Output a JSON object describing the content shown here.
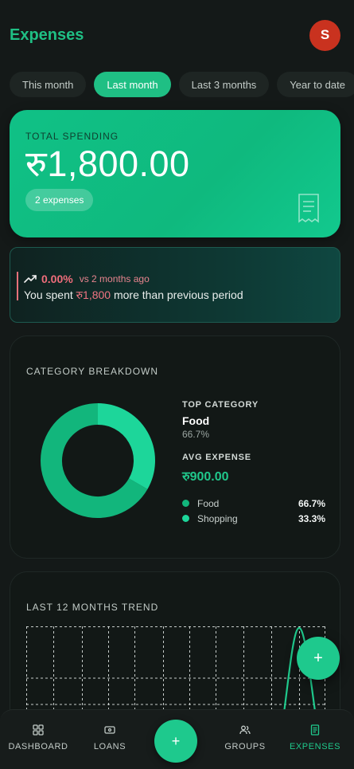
{
  "header": {
    "title": "Expenses",
    "avatar_initial": "S"
  },
  "periods": [
    {
      "label": "This month",
      "active": false
    },
    {
      "label": "Last month",
      "active": true
    },
    {
      "label": "Last 3 months",
      "active": false
    },
    {
      "label": "Year to date",
      "active": false
    }
  ],
  "total": {
    "label": "TOTAL SPENDING",
    "amount": "रु1,800.00",
    "count_label": "2 expenses",
    "icon": "receipt-icon"
  },
  "comparison": {
    "percent": "0.00%",
    "vs_label": "vs 2 months ago",
    "text_before": "You spent ",
    "amount": "रु1,800",
    "text_after": " more than previous period",
    "icon": "trending-up-icon"
  },
  "category": {
    "title": "CATEGORY BREAKDOWN",
    "top_heading": "TOP CATEGORY",
    "top_name": "Food",
    "top_pct": "66.7%",
    "avg_heading": "AVG EXPENSE",
    "avg_value": "रु900.00",
    "legend": [
      {
        "name": "Food",
        "pct": "66.7%",
        "color": "#12b67c"
      },
      {
        "name": "Shopping",
        "pct": "33.3%",
        "color": "#1dd69a"
      }
    ]
  },
  "chart_data": [
    {
      "type": "pie",
      "labels": [
        "Food",
        "Shopping"
      ],
      "values": [
        66.7,
        33.3
      ],
      "colors": [
        "#12b67c",
        "#1dd69a"
      ]
    },
    {
      "type": "line",
      "title": "LAST 12 MONTHS TREND",
      "x": [
        1,
        2,
        3,
        4,
        5,
        6,
        7,
        8,
        9,
        10,
        11,
        12
      ],
      "series": [
        {
          "values": [
            0,
            0,
            0,
            0,
            0,
            0,
            0,
            0,
            0,
            0,
            0,
            1800
          ]
        }
      ],
      "grid": true,
      "color": "#1fc98c"
    }
  ],
  "trend": {
    "title": "LAST 12 MONTHS TREND"
  },
  "fab": {
    "label": "+"
  },
  "nav": {
    "items": [
      {
        "label": "DASHBOARD",
        "icon": "grid-icon",
        "active": false
      },
      {
        "label": "LOANS",
        "icon": "wallet-icon",
        "active": false
      },
      {
        "label": "GROUPS",
        "icon": "users-icon",
        "active": false
      },
      {
        "label": "EXPENSES",
        "icon": "document-icon",
        "active": true
      }
    ],
    "add_label": "+"
  }
}
